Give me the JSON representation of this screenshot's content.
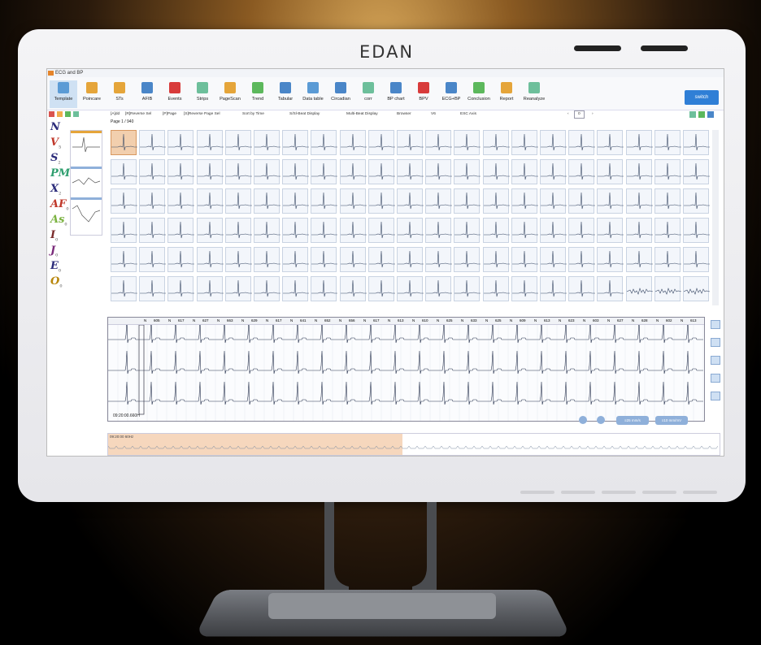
{
  "brand": "EDAN",
  "window_title": "ECG and BP",
  "toolbar": {
    "items": [
      {
        "label": "Template",
        "color": "#5b9bd5",
        "active": true
      },
      {
        "label": "Poincare",
        "color": "#e5a53a"
      },
      {
        "label": "STs",
        "color": "#e5a53a"
      },
      {
        "label": "AFIB",
        "color": "#4a86c8"
      },
      {
        "label": "Events",
        "color": "#d83b3b"
      },
      {
        "label": "Strips",
        "color": "#6dbf9b"
      },
      {
        "label": "PageScan",
        "color": "#e5a53a"
      },
      {
        "label": "Trend",
        "color": "#5cb85c"
      },
      {
        "label": "Tabular",
        "color": "#4a86c8"
      },
      {
        "label": "Data table",
        "color": "#5b9bd5"
      },
      {
        "label": "Circadian",
        "color": "#4a86c8"
      },
      {
        "label": "corr",
        "color": "#6dbf9b"
      },
      {
        "label": "BP chart",
        "color": "#4a86c8"
      },
      {
        "label": "BPV",
        "color": "#d83b3b"
      },
      {
        "label": "ECG+BP",
        "color": "#4a86c8"
      },
      {
        "label": "Conclusion",
        "color": "#5cb85c"
      },
      {
        "label": "Report",
        "color": "#e5a53a"
      },
      {
        "label": "Reanalyze",
        "color": "#6dbf9b"
      }
    ],
    "switch_label": "switch"
  },
  "options": {
    "add": "[A]dd",
    "reverse_sel": "[R]Reverse Sel",
    "page": "[P]Page",
    "reverse_page_sel": "[S]Reverse Page Sel",
    "sort": "Sort by Time",
    "single_beat": "S/Sl-Beat Display",
    "multi_beat": "Multi-Beat Display",
    "lead": "Browser",
    "count": "V6",
    "esc_axis": "ESC Axis",
    "page_num": "0"
  },
  "page_label": "Page 1 / 940",
  "classes": [
    {
      "letter": "N",
      "count": "",
      "color": "#2b2b7a"
    },
    {
      "letter": "V",
      "count": "5",
      "color": "#c0392b"
    },
    {
      "letter": "S",
      "count": "2",
      "color": "#2b2b7a"
    },
    {
      "letter": "PM",
      "count": "0",
      "color": "#2e9e6e"
    },
    {
      "letter": "X",
      "count": "2",
      "color": "#2b2b7a"
    },
    {
      "letter": "AF",
      "count": "0",
      "color": "#c0392b"
    },
    {
      "letter": "As",
      "count": "0",
      "color": "#7cb342"
    },
    {
      "letter": "I",
      "count": "0",
      "color": "#7a2b2b"
    },
    {
      "letter": "J",
      "count": "0",
      "color": "#7a2b7a"
    },
    {
      "letter": "E",
      "count": "0",
      "color": "#2b2b7a"
    },
    {
      "letter": "O",
      "count": "0",
      "color": "#b8860b"
    }
  ],
  "ruler_values": [
    "605",
    "617",
    "627",
    "663",
    "629",
    "617",
    "641",
    "652",
    "656",
    "617",
    "613",
    "610",
    "625",
    "633",
    "625",
    "609",
    "613",
    "623",
    "603",
    "627",
    "628",
    "602",
    "613"
  ],
  "strip_time": "09:20:00.660H",
  "strip_ctrl": [
    "≡25 mm/s",
    "≡10 mm/mV"
  ],
  "overview_time": "09:20:00 60Hz",
  "grid": {
    "cols": 21,
    "rows": 6
  }
}
